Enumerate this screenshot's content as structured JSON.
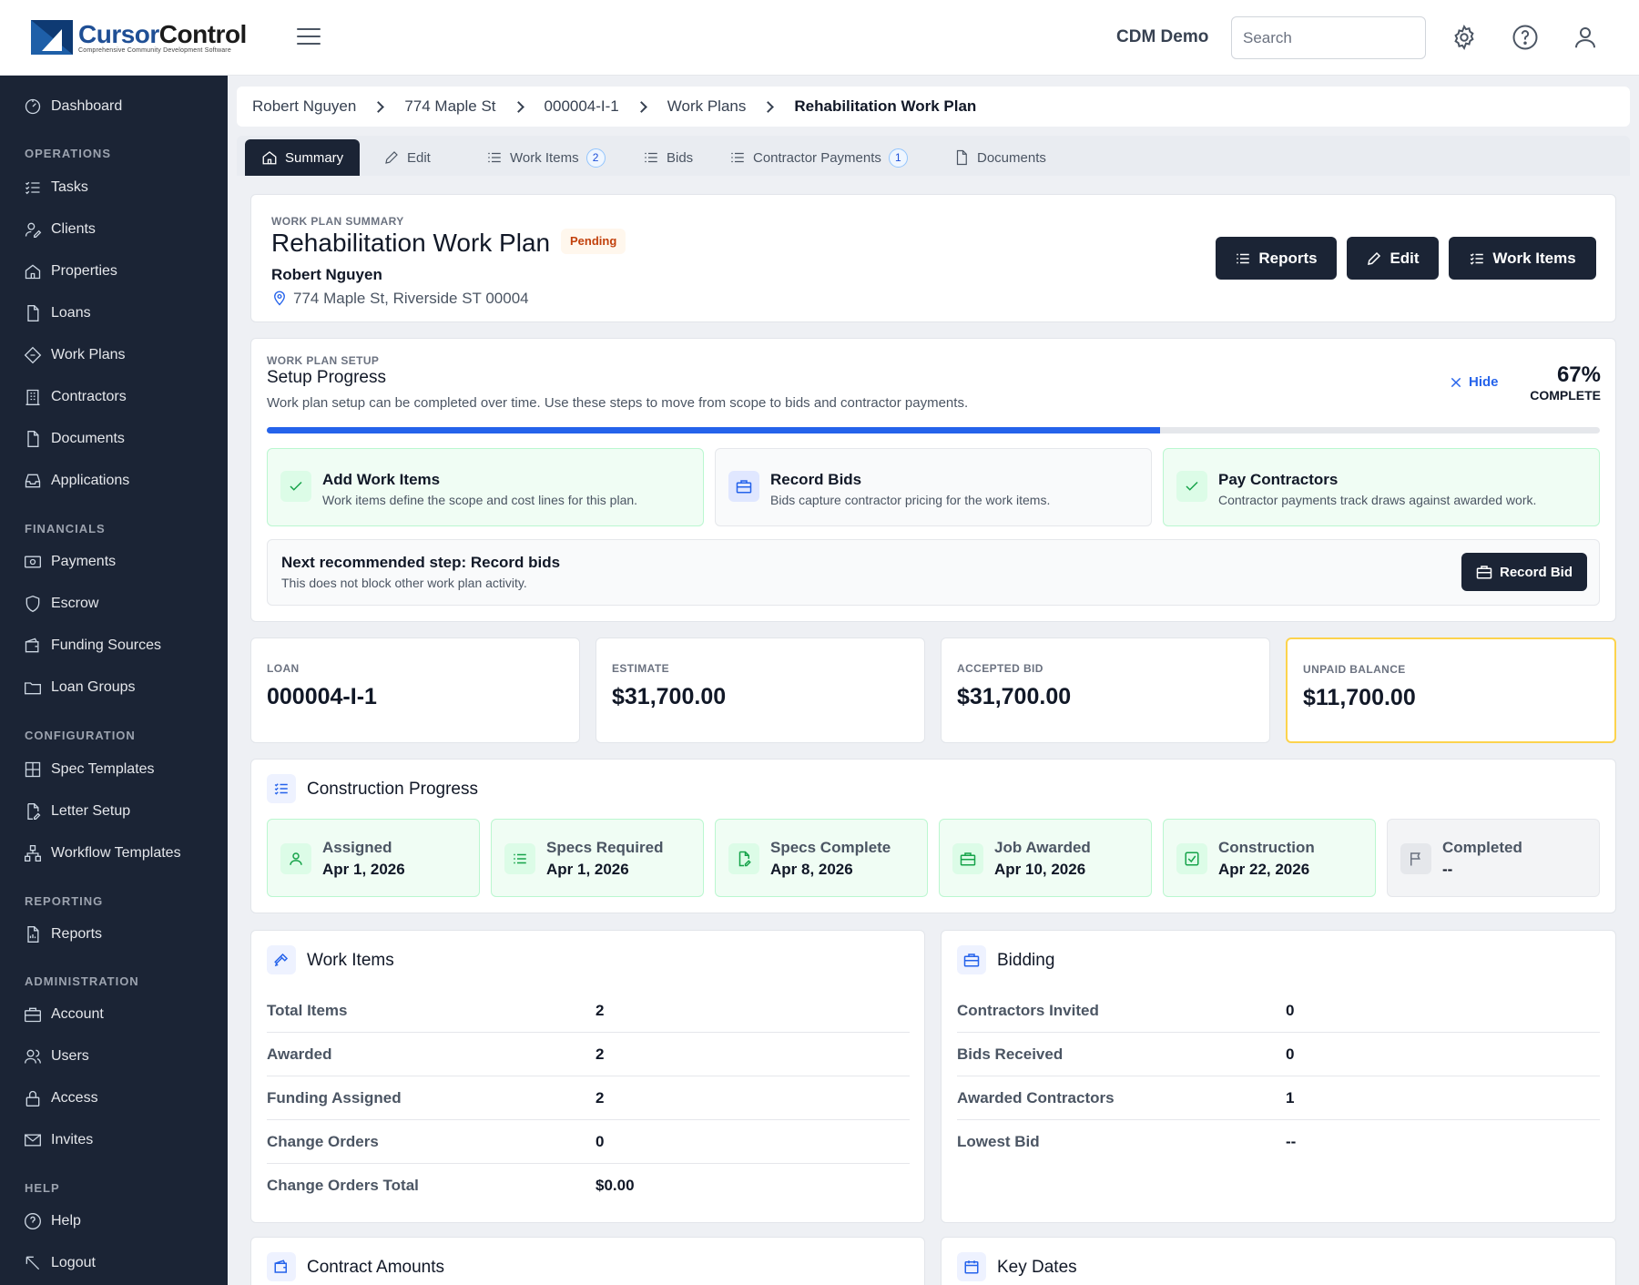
{
  "app": {
    "logo_title_1": "Cursor",
    "logo_title_2": "Control",
    "logo_subtitle": "Comprehensive Community Development Software",
    "company": "CDM Demo",
    "search_placeholder": "Search"
  },
  "sidebar": {
    "dashboard": "Dashboard",
    "sections": {
      "operations": "OPERATIONS",
      "financials": "FINANCIALS",
      "configuration": "CONFIGURATION",
      "reporting": "REPORTING",
      "administration": "ADMINISTRATION",
      "help": "HELP"
    },
    "items": {
      "tasks": "Tasks",
      "clients": "Clients",
      "properties": "Properties",
      "loans": "Loans",
      "work_plans": "Work Plans",
      "contractors": "Contractors",
      "documents": "Documents",
      "applications": "Applications",
      "payments": "Payments",
      "escrow": "Escrow",
      "funding_sources": "Funding Sources",
      "loan_groups": "Loan Groups",
      "spec_templates": "Spec Templates",
      "letter_setup": "Letter Setup",
      "workflow_templates": "Workflow Templates",
      "reports": "Reports",
      "account": "Account",
      "users": "Users",
      "access": "Access",
      "invites": "Invites",
      "help": "Help",
      "logout": "Logout"
    }
  },
  "breadcrumb": [
    "Robert Nguyen",
    "774 Maple St",
    "000004-I-1",
    "Work Plans",
    "Rehabilitation Work Plan"
  ],
  "tabs": {
    "summary": "Summary",
    "edit": "Edit",
    "work_items": "Work Items",
    "work_items_count": "2",
    "bids": "Bids",
    "contractor_payments": "Contractor Payments",
    "contractor_payments_count": "1",
    "documents": "Documents"
  },
  "summary": {
    "eyebrow": "WORK PLAN SUMMARY",
    "title": "Rehabilitation Work Plan",
    "status": "Pending",
    "client": "Robert Nguyen",
    "address": "774 Maple St, Riverside ST 00004",
    "buttons": {
      "reports": "Reports",
      "edit": "Edit",
      "work_items": "Work Items"
    }
  },
  "setup": {
    "eyebrow": "WORK PLAN SETUP",
    "title": "Setup Progress",
    "description": "Work plan setup can be completed over time. Use these steps to move from scope to bids and contractor payments.",
    "hide": "Hide",
    "percent_label": "67%",
    "complete_label": "COMPLETE",
    "progress": 0.67,
    "steps": [
      {
        "title": "Add Work Items",
        "desc": "Work items define the scope and cost lines for this plan."
      },
      {
        "title": "Record Bids",
        "desc": "Bids capture contractor pricing for the work items."
      },
      {
        "title": "Pay Contractors",
        "desc": "Contractor payments track draws against awarded work."
      }
    ],
    "next_step_title": "Next recommended step: Record bids",
    "next_step_desc": "This does not block other work plan activity.",
    "record_bid": "Record Bid"
  },
  "stats": [
    {
      "label": "LOAN",
      "value": "000004-I-1"
    },
    {
      "label": "ESTIMATE",
      "value": "$31,700.00"
    },
    {
      "label": "ACCEPTED BID",
      "value": "$31,700.00"
    },
    {
      "label": "UNPAID BALANCE",
      "value": "$11,700.00"
    }
  ],
  "construction": {
    "title": "Construction Progress",
    "stages": [
      {
        "label": "Assigned",
        "value": "Apr 1, 2026"
      },
      {
        "label": "Specs Required",
        "value": "Apr 1, 2026"
      },
      {
        "label": "Specs Complete",
        "value": "Apr 8, 2026"
      },
      {
        "label": "Job Awarded",
        "value": "Apr 10, 2026"
      },
      {
        "label": "Construction",
        "value": "Apr 22, 2026"
      },
      {
        "label": "Completed",
        "value": "--"
      }
    ]
  },
  "work_items": {
    "title": "Work Items",
    "rows": [
      {
        "k": "Total Items",
        "v": "2"
      },
      {
        "k": "Awarded",
        "v": "2"
      },
      {
        "k": "Funding Assigned",
        "v": "2"
      },
      {
        "k": "Change Orders",
        "v": "0"
      },
      {
        "k": "Change Orders Total",
        "v": "$0.00"
      }
    ]
  },
  "bidding": {
    "title": "Bidding",
    "rows": [
      {
        "k": "Contractors Invited",
        "v": "0"
      },
      {
        "k": "Bids Received",
        "v": "0"
      },
      {
        "k": "Awarded Contractors",
        "v": "1"
      },
      {
        "k": "Lowest Bid",
        "v": "--"
      }
    ]
  },
  "contract_amounts": {
    "title": "Contract Amounts"
  },
  "key_dates": {
    "title": "Key Dates"
  },
  "colors": {
    "sidebar": "#1b2435",
    "accent": "#2563eb",
    "success_bg": "#f0fdf4",
    "warning_border": "#fbbf24",
    "pending_text": "#c2410c"
  }
}
